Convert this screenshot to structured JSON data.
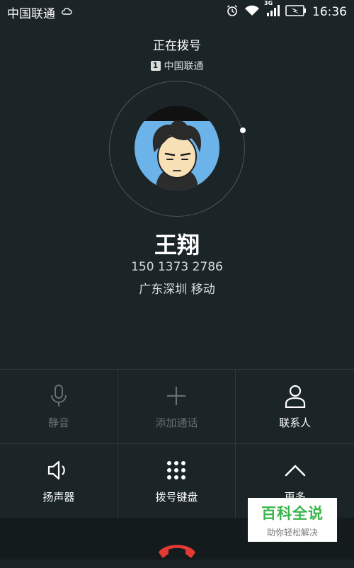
{
  "status_bar": {
    "carrier": "中国联通",
    "network_type": "3G",
    "time": "16:36",
    "icons": [
      "cloud-icon",
      "alarm-icon",
      "wifi-icon",
      "signal-icon",
      "battery-charging-icon"
    ]
  },
  "call": {
    "status": "正在拨号",
    "sim_slot": "1",
    "sim_carrier": "中国联通"
  },
  "contact": {
    "name": "王翔",
    "number": "150 1373 2786",
    "location": "广东深圳 移动"
  },
  "controls": [
    {
      "label": "静音",
      "icon": "microphone-icon",
      "enabled": false
    },
    {
      "label": "添加通话",
      "icon": "plus-icon",
      "enabled": false
    },
    {
      "label": "联系人",
      "icon": "person-icon",
      "enabled": true
    },
    {
      "label": "扬声器",
      "icon": "speaker-icon",
      "enabled": true
    },
    {
      "label": "拨号键盘",
      "icon": "dialpad-icon",
      "enabled": true
    },
    {
      "label": "更多",
      "icon": "chevron-up-icon",
      "enabled": true
    }
  ],
  "end_call": {
    "icon": "end-call-icon",
    "color": "#e53935"
  },
  "watermark": {
    "title": "百科全说",
    "subtitle": "助你轻松解决"
  },
  "colors": {
    "background": "#1b2427",
    "text_primary": "#ffffff",
    "text_secondary": "#d7dcdd",
    "text_disabled": "#65706f",
    "divider": "#2f383b",
    "end_call_red": "#e53935",
    "watermark_green": "#39b54a"
  }
}
